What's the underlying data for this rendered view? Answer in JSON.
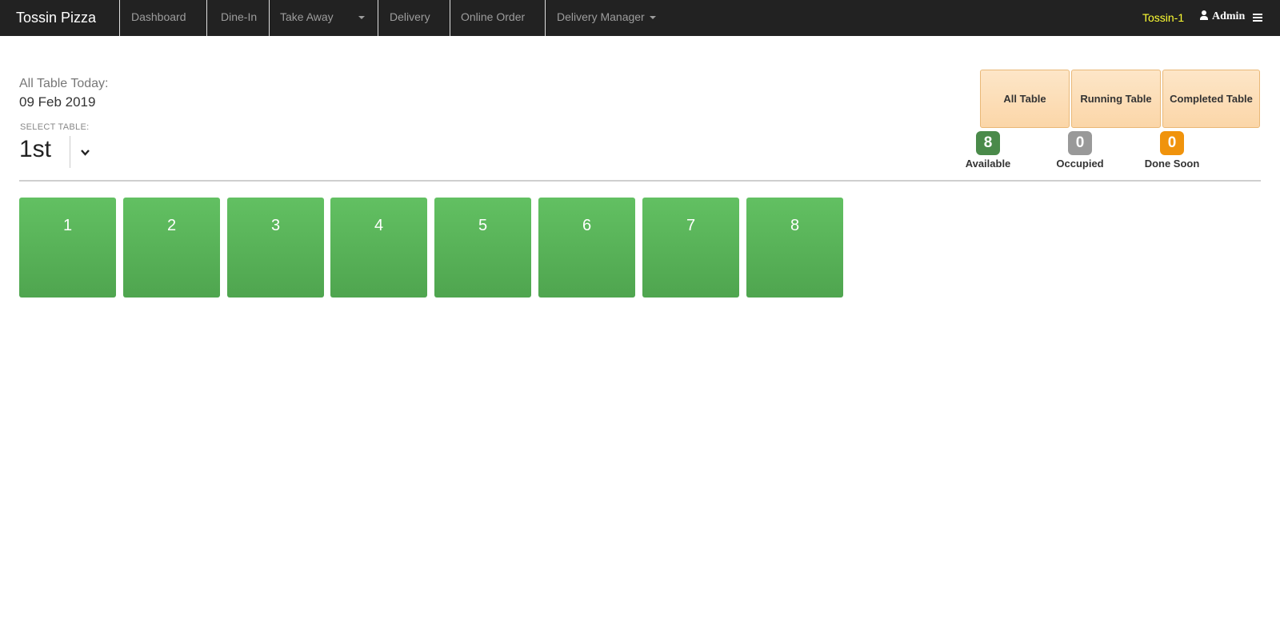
{
  "navbar": {
    "brand": "Tossin Pizza",
    "items": [
      {
        "label": "Dashboard"
      },
      {
        "label": "Dine-In"
      },
      {
        "label": "Take Away"
      },
      {
        "label": "Delivery"
      },
      {
        "label": "Online Order"
      },
      {
        "label": "Delivery Manager"
      }
    ],
    "store": "Tossin-1",
    "user": "Admin",
    "icons": {
      "user": "user-icon",
      "menu": "hamburger-menu-icon",
      "dropdown": "caret-down-icon"
    }
  },
  "header": {
    "today_label": "All Table Today:",
    "date": "09 Feb 2019",
    "select_label": "SELECT TABLE:",
    "selected_floor": "1st"
  },
  "filters": [
    {
      "label": "All Table"
    },
    {
      "label": "Running Table"
    },
    {
      "label": "Completed Table"
    }
  ],
  "status": [
    {
      "count": "8",
      "label": "Available",
      "color": "#4a8a4a"
    },
    {
      "count": "0",
      "label": "Occupied",
      "color": "#999999"
    },
    {
      "count": "0",
      "label": "Done Soon",
      "color": "#f0930c"
    }
  ],
  "tables": [
    "1",
    "2",
    "3",
    "4",
    "5",
    "6",
    "7",
    "8"
  ],
  "colors": {
    "table_available": "#5cb85c",
    "filter_bg": "#fde1bd",
    "store_text": "#ffff33"
  }
}
